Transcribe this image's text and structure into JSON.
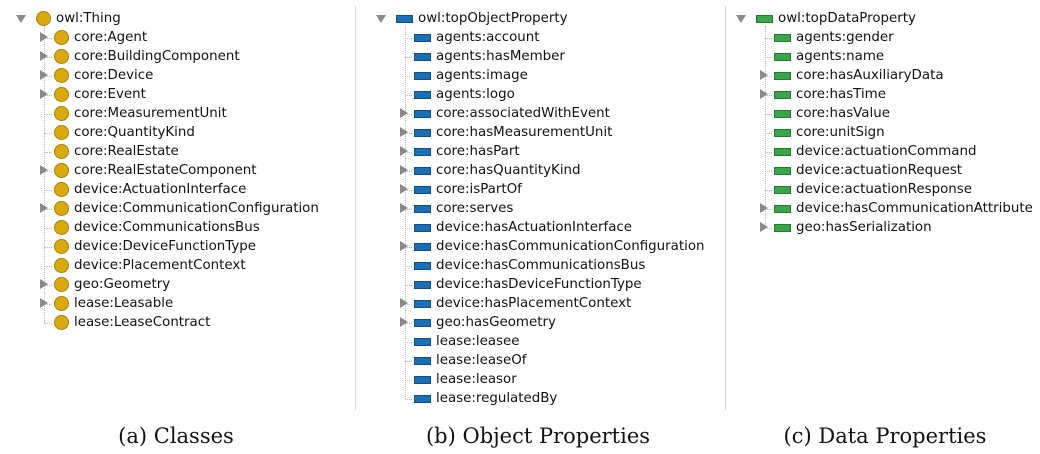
{
  "panels": [
    {
      "caption": "(a) Classes",
      "icon": "class-circle-icon",
      "root": {
        "label": "owl:Thing",
        "expanded": true
      },
      "items": [
        {
          "label": "core:Agent",
          "arrow": true
        },
        {
          "label": "core:BuildingComponent",
          "arrow": true
        },
        {
          "label": "core:Device",
          "arrow": true
        },
        {
          "label": "core:Event",
          "arrow": true
        },
        {
          "label": "core:MeasurementUnit",
          "arrow": false
        },
        {
          "label": "core:QuantityKind",
          "arrow": false
        },
        {
          "label": "core:RealEstate",
          "arrow": false
        },
        {
          "label": "core:RealEstateComponent",
          "arrow": true
        },
        {
          "label": "device:ActuationInterface",
          "arrow": false
        },
        {
          "label": "device:CommunicationConfiguration",
          "arrow": true
        },
        {
          "label": "device:CommunicationsBus",
          "arrow": false
        },
        {
          "label": "device:DeviceFunctionType",
          "arrow": false
        },
        {
          "label": "device:PlacementContext",
          "arrow": false
        },
        {
          "label": "geo:Geometry",
          "arrow": true
        },
        {
          "label": "lease:Leasable",
          "arrow": true
        },
        {
          "label": "lease:LeaseContract",
          "arrow": false
        }
      ]
    },
    {
      "caption": "(b) Object Properties",
      "icon": "object-property-icon",
      "root": {
        "label": "owl:topObjectProperty",
        "expanded": true
      },
      "items": [
        {
          "label": "agents:account",
          "arrow": false
        },
        {
          "label": "agents:hasMember",
          "arrow": false
        },
        {
          "label": "agents:image",
          "arrow": false
        },
        {
          "label": "agents:logo",
          "arrow": false
        },
        {
          "label": "core:associatedWithEvent",
          "arrow": true
        },
        {
          "label": "core:hasMeasurementUnit",
          "arrow": true
        },
        {
          "label": "core:hasPart",
          "arrow": true
        },
        {
          "label": "core:hasQuantityKind",
          "arrow": true
        },
        {
          "label": "core:isPartOf",
          "arrow": true
        },
        {
          "label": "core:serves",
          "arrow": true
        },
        {
          "label": "device:hasActuationInterface",
          "arrow": false
        },
        {
          "label": "device:hasCommunicationConfiguration",
          "arrow": true
        },
        {
          "label": "device:hasCommunicationsBus",
          "arrow": false
        },
        {
          "label": "device:hasDeviceFunctionType",
          "arrow": false
        },
        {
          "label": "device:hasPlacementContext",
          "arrow": true
        },
        {
          "label": "geo:hasGeometry",
          "arrow": true
        },
        {
          "label": "lease:leasee",
          "arrow": false
        },
        {
          "label": "lease:leaseOf",
          "arrow": false
        },
        {
          "label": "lease:leasor",
          "arrow": false
        },
        {
          "label": "lease:regulatedBy",
          "arrow": false
        }
      ]
    },
    {
      "caption": "(c) Data Properties",
      "icon": "data-property-icon",
      "root": {
        "label": "owl:topDataProperty",
        "expanded": true
      },
      "items": [
        {
          "label": "agents:gender",
          "arrow": false
        },
        {
          "label": "agents:name",
          "arrow": false
        },
        {
          "label": "core:hasAuxiliaryData",
          "arrow": true
        },
        {
          "label": "core:hasTime",
          "arrow": true
        },
        {
          "label": "core:hasValue",
          "arrow": false
        },
        {
          "label": "core:unitSign",
          "arrow": false
        },
        {
          "label": "device:actuationCommand",
          "arrow": false
        },
        {
          "label": "device:actuationRequest",
          "arrow": false
        },
        {
          "label": "device:actuationResponse",
          "arrow": false
        },
        {
          "label": "device:hasCommunicationAttribute",
          "arrow": true
        },
        {
          "label": "geo:hasSerialization",
          "arrow": true
        }
      ]
    }
  ]
}
